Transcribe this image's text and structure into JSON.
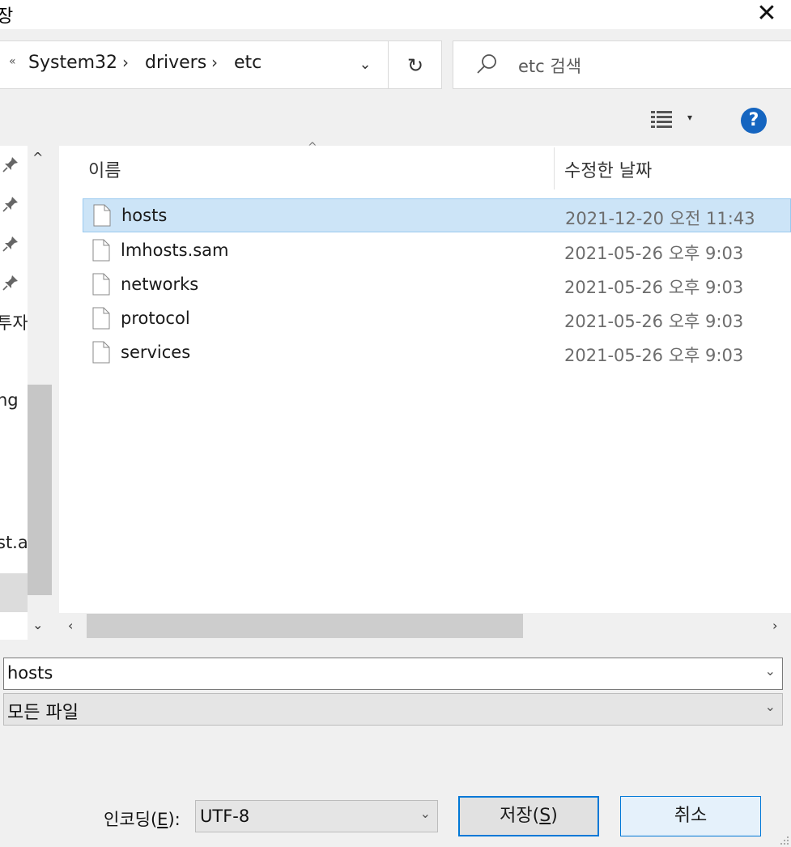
{
  "window": {
    "title_fragment": "장",
    "close_glyph": "✕"
  },
  "address": {
    "overflow": "«",
    "crumbs": [
      "System32",
      "drivers",
      "etc"
    ],
    "separator": "›",
    "dropdown": "⌄",
    "refresh": "↻"
  },
  "search": {
    "placeholder": "etc 검색"
  },
  "toolbar": {
    "view_dropdown": "▾",
    "help": "?"
  },
  "nav": {
    "pins": [
      "📌",
      "📌",
      "📌",
      "📌"
    ],
    "texts": [
      "투자.",
      "ng",
      "st.a"
    ],
    "scroll_up": "^",
    "scroll_down": "⌄"
  },
  "columns": {
    "name": "이름",
    "date": "수정한 날짜",
    "sort_glyph": "^"
  },
  "files": [
    {
      "name": "hosts",
      "date": "2021-12-20 오전 11:43",
      "selected": true
    },
    {
      "name": "lmhosts.sam",
      "date": "2021-05-26 오후 9:03"
    },
    {
      "name": "networks",
      "date": "2021-05-26 오후 9:03"
    },
    {
      "name": "protocol",
      "date": "2021-05-26 오후 9:03"
    },
    {
      "name": "services",
      "date": "2021-05-26 오후 9:03"
    }
  ],
  "hscroll": {
    "left": "‹",
    "right": "›"
  },
  "filename": {
    "value": "hosts",
    "arrow": "⌄"
  },
  "filetype": {
    "value": "모든 파일",
    "arrow": "⌄"
  },
  "encoding": {
    "label_pre": "인코딩(",
    "label_key": "E",
    "label_post": "):",
    "value": "UTF-8",
    "arrow": "⌄"
  },
  "buttons": {
    "save_pre": "저장(",
    "save_key": "S",
    "save_post": ")",
    "cancel": "취소"
  },
  "colors": {
    "selection": "#cce4f7",
    "accent": "#0078d7",
    "help": "#1565c0"
  }
}
